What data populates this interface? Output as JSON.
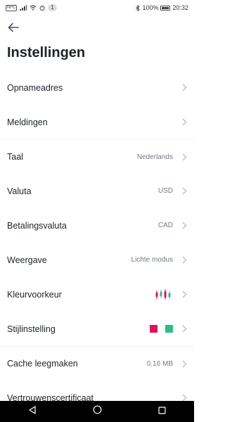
{
  "status_bar": {
    "sim_label": "NFC",
    "notification_count": "1",
    "battery_text": "100%",
    "time": "20:32"
  },
  "header": {
    "title": "Instellingen"
  },
  "settings": [
    {
      "label": "Opnameadres",
      "value": ""
    },
    {
      "label": "Meldingen",
      "value": ""
    },
    {
      "label": "Taal",
      "value": "Nederlands"
    },
    {
      "label": "Valuta",
      "value": "USD"
    },
    {
      "label": "Betalingsvaluta",
      "value": "CAD"
    },
    {
      "label": "Weergave",
      "value": "Lichte modus"
    },
    {
      "label": "Kleurvoorkeur",
      "value": ""
    },
    {
      "label": "Stijlinstelling",
      "value": ""
    },
    {
      "label": "Cache leegmaken",
      "value": "0.16 MB"
    },
    {
      "label": "Vertrouwenscertificaat",
      "value": ""
    }
  ],
  "colors": {
    "down": "#e0115f",
    "up": "#2ebd85"
  },
  "icons": [
    "back-arrow-icon",
    "chevron-right-icon",
    "candlestick-icon",
    "nav-back-icon",
    "nav-home-icon",
    "nav-recents-icon"
  ]
}
